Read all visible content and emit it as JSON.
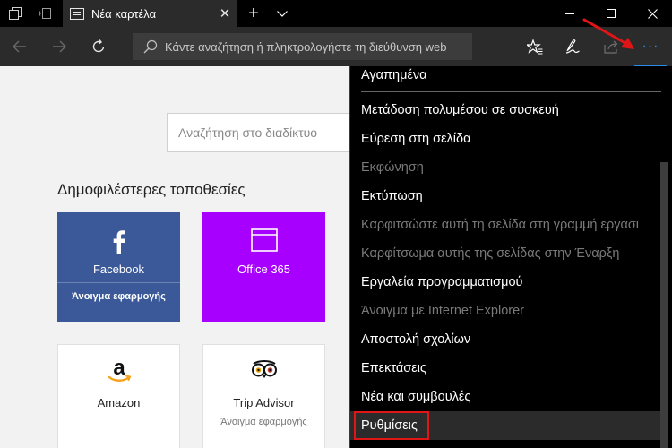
{
  "titlebar": {
    "tab_title": "Νέα καρτέλα",
    "new_tab_symbol": "+",
    "close_symbol": "✕"
  },
  "toolbar": {
    "address_placeholder": "Κάντε αναζήτηση ή πληκτρολογήστε τη διεύθυνση web",
    "more_symbol": "···"
  },
  "page": {
    "search_placeholder": "Αναζήτηση στο διαδίκτυο",
    "top_sites_title": "Δημοφιλέστερες τοποθεσίες",
    "tiles": [
      {
        "name": "Facebook",
        "sub": "Άνοιγμα εφαρμογής"
      },
      {
        "name": "Office 365",
        "sub": ""
      },
      {
        "name": "Amazon",
        "sub": ""
      },
      {
        "name": "Trip Advisor",
        "sub": "Άνοιγμα εφαρμογής"
      }
    ]
  },
  "menu": {
    "items": [
      {
        "label": "Αγαπημένα",
        "enabled": true
      },
      {
        "label": "Μετάδοση πολυμέσου σε συσκευή",
        "enabled": true
      },
      {
        "label": "Εύρεση στη σελίδα",
        "enabled": true
      },
      {
        "label": "Εκφώνηση",
        "enabled": false
      },
      {
        "label": "Εκτύπωση",
        "enabled": true
      },
      {
        "label": "Καρφιτσώστε αυτή τη σελίδα στη γραμμή εργασι",
        "enabled": false
      },
      {
        "label": "Καρφίτσωμα αυτής της σελίδας στην Έναρξη",
        "enabled": false
      },
      {
        "label": "Εργαλεία προγραμματισμού",
        "enabled": true
      },
      {
        "label": "Άνοιγμα με Internet Explorer",
        "enabled": false
      },
      {
        "label": "Αποστολή σχολίων",
        "enabled": true
      },
      {
        "label": "Επεκτάσεις",
        "enabled": true
      },
      {
        "label": "Νέα και συμβουλές",
        "enabled": true
      },
      {
        "label": "Ρυθμίσεις",
        "enabled": true
      }
    ]
  },
  "colors": {
    "accent": "#2b8ce8",
    "highlight_box": "#e01515",
    "facebook": "#3b5998",
    "office365": "#a700ff"
  }
}
